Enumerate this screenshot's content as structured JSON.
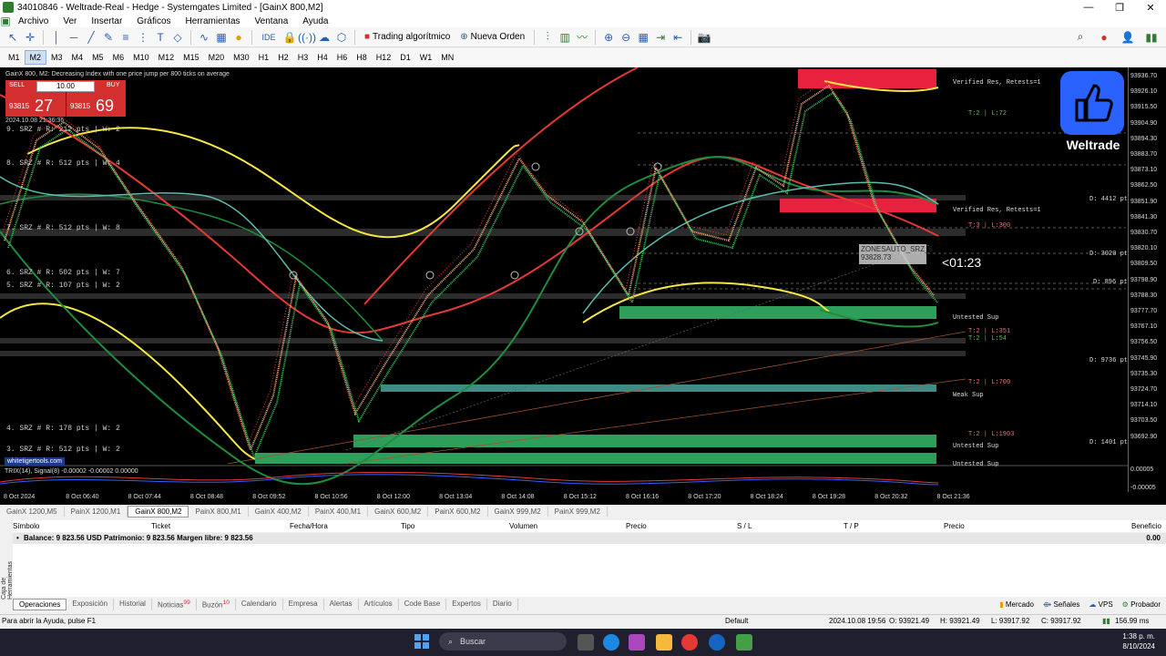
{
  "window": {
    "title": "34010846 - Weltrade-Real - Hedge - Systemgates Limited - [GainX 800,M2]"
  },
  "menu": [
    "Archivo",
    "Ver",
    "Insertar",
    "Gráficos",
    "Herramientas",
    "Ventana",
    "Ayuda"
  ],
  "toolbar": {
    "algo_label": "Trading algorítmico",
    "new_order_label": "Nueva Orden",
    "ide_label": "IDE"
  },
  "timeframes": [
    "M1",
    "M2",
    "M3",
    "M4",
    "M5",
    "M6",
    "M10",
    "M12",
    "M15",
    "M20",
    "M30",
    "H1",
    "H2",
    "H3",
    "H4",
    "H6",
    "H8",
    "H12",
    "D1",
    "W1",
    "MN"
  ],
  "active_timeframe": "M2",
  "chart": {
    "header": "GainX 800, M2:  Decreasing Index with one price jump per 800 ticks on average",
    "trade": {
      "sell_label": "SELL",
      "buy_label": "BUY",
      "qty": "10.00",
      "sell_small": "93815",
      "sell_big": "27",
      "buy_small": "93815",
      "buy_big": "69"
    },
    "timestamp": "2024.10.08 21:36:36",
    "srz_labels": [
      "9. SRZ # R: 212 pts | W: 2",
      "8. SRZ # R: 512 pts | W: 4",
      "7. SRZ # R: 512 pts | W: 8",
      "6. SRZ # R: 502 pts | W: 7",
      "5. SRZ # R: 107 pts | W: 2",
      "4. SRZ # R: 178 pts | W: 2",
      "3. SRZ # R: 512 pts | W: 2"
    ],
    "zone_texts": {
      "verified_res_1": "Verified Res, Retests=1",
      "verified_res_2": "Verified Res, Retests=1",
      "t2_72": "T:2 | L:72",
      "t3_300": "T:3 | L:300",
      "untested_sup_1": "Untested Sup",
      "t2_351": "T:2 | L:351",
      "t2_54": "T:2 | L:54",
      "t2_700": "T:2 | L:700",
      "weak_sup": "Weak Sup",
      "t2_1903": "T:2 | L:1903",
      "untested_sup_2": "Untested Sup",
      "untested_sup_3": "Untested Sup",
      "d_4412": "D: 4412 pts",
      "d_3020": "D: 3020 pts",
      "d_896": "D: 896 pts",
      "d_9736": "D: 9736 pts",
      "d_1401": "D: 1401 pts"
    },
    "info_box": {
      "line1": "ZONESAUTO_SRZ_6",
      "line2": "93828.73"
    },
    "countdown": "<01:23",
    "logo_text": "Weltrade",
    "site_tag": "whitetigertools.com",
    "trix_label": "TRIX(14), Signal(8) -0.00002 -0.00002 0.00000",
    "price_labels": [
      "93936.70",
      "93926.10",
      "93915.50",
      "93904.90",
      "93894.30",
      "93883.70",
      "93873.10",
      "93862.50",
      "93851.90",
      "93841.30",
      "93830.70",
      "93820.10",
      "93809.50",
      "93798.90",
      "93788.30",
      "93777.70",
      "93767.10",
      "93756.50",
      "93745.90",
      "93735.30",
      "93724.70",
      "93714.10",
      "93703.50",
      "93692.90"
    ],
    "trix_axis": [
      "0.00005",
      "-0.00005"
    ],
    "time_labels": [
      "8 Oct 2024",
      "8 Oct 06:40",
      "8 Oct 07:44",
      "8 Oct 08:48",
      "8 Oct 09:52",
      "8 Oct 10:56",
      "8 Oct 12:00",
      "8 Oct 13:04",
      "8 Oct 14:08",
      "8 Oct 15:12",
      "8 Oct 16:16",
      "8 Oct 17:20",
      "8 Oct 18:24",
      "8 Oct 19:28",
      "8 Oct 20:32",
      "8 Oct 21:36"
    ]
  },
  "chart_tabs": [
    "GainX 1200,M5",
    "PainX 1200,M1",
    "GainX 800,M2",
    "PainX 800,M1",
    "GainX 400,M2",
    "PainX 400,M1",
    "GainX 600,M2",
    "PainX 600,M2",
    "GainX 999,M2",
    "PainX 999,M2"
  ],
  "active_chart_tab": "GainX 800,M2",
  "orders": {
    "columns": [
      "Símbolo",
      "Ticket",
      "Fecha/Hora",
      "Tipo",
      "Volumen",
      "Precio",
      "S / L",
      "T / P",
      "Precio",
      "Beneficio"
    ],
    "balance_text": "Balance: 9 823.56 USD  Patrimonio: 9 823.56  Margen libre: 9 823.56",
    "balance_profit": "0.00"
  },
  "side_label": "Caja de Herramientas",
  "bottom_tabs": [
    "Operaciones",
    "Exposición",
    "Historial",
    "Noticias",
    "Buzón",
    "Calendario",
    "Empresa",
    "Alertas",
    "Artículos",
    "Code Base",
    "Expertos",
    "Diario"
  ],
  "news_badge": "99",
  "mail_badge": "10",
  "bottom_right": [
    "Mercado",
    "Señales",
    "VPS",
    "Probador"
  ],
  "statusbar": {
    "help": "Para abrir la Ayuda, pulse F1",
    "profile": "Default",
    "datetime": "2024.10.08 19:56",
    "open": "O: 93921.49",
    "high": "H: 93921.49",
    "low": "L: 93917.92",
    "close": "C: 93917.92",
    "ping": "156.99 ms"
  },
  "taskbar": {
    "search": "Buscar",
    "time": "1:38 p. m.",
    "date": "8/10/2024"
  },
  "colors": {
    "accent": "#2962ff",
    "sell": "#d32f2f",
    "res_zone": "#e8213f",
    "sup_zone": "#2e9e5b",
    "weak_zone": "#3d8d86"
  }
}
